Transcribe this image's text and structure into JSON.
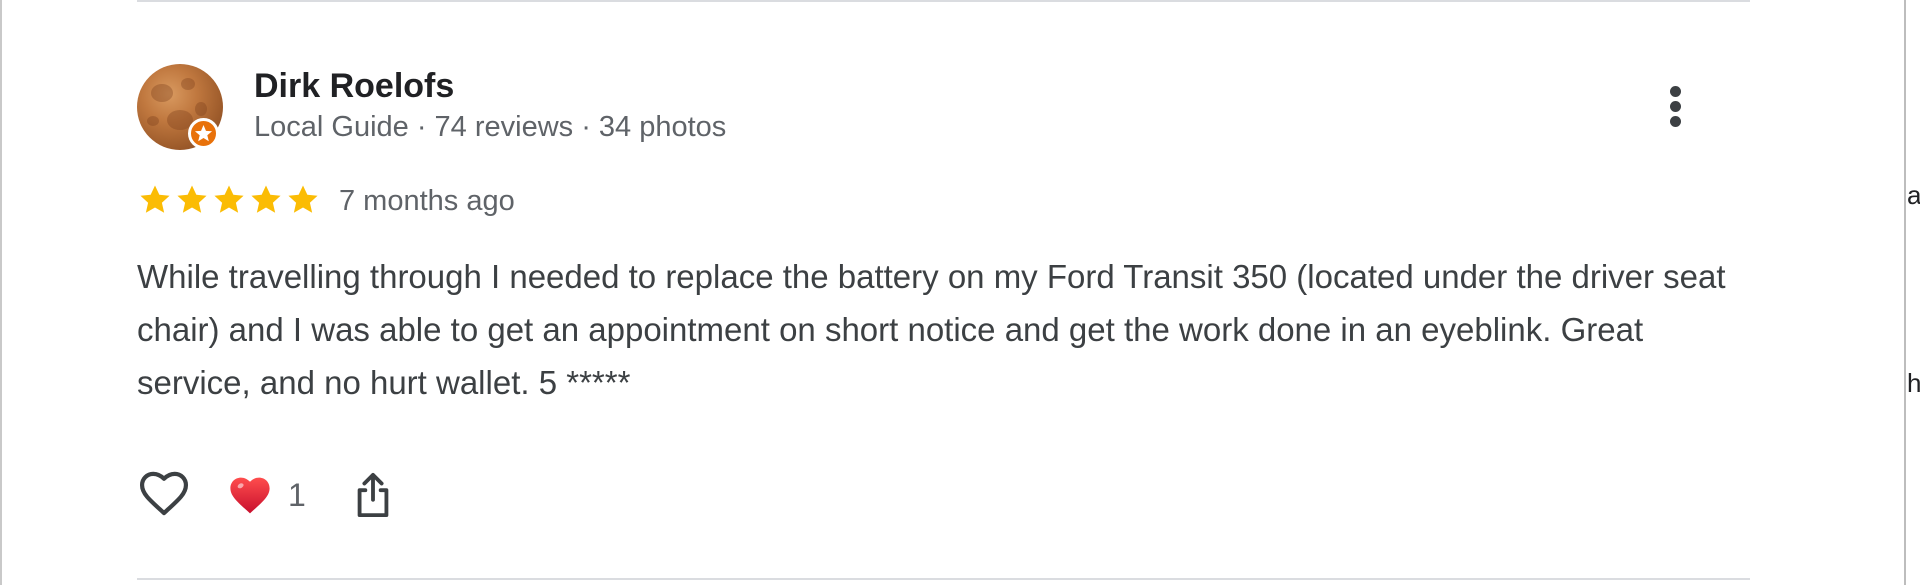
{
  "review": {
    "author": {
      "name": "Dirk Roelofs",
      "meta": "Local Guide · 74 reviews · 34 photos",
      "avatar_icon": "moon-photo-avatar",
      "badge_icon": "local-guide-star-icon"
    },
    "rating": 5,
    "rating_max": 5,
    "date": "7 months ago",
    "text": "While travelling through I needed to replace the battery on my Ford Transit 350 (located under the driver seat chair) and I was able to get an appointment on short notice and get the work done in an eyeblink. Great service, and no hurt wallet. 5 *****",
    "actions": {
      "like_icon": "heart-outline-icon",
      "reaction_icon": "red-heart-emoji",
      "reaction_count": "1",
      "share_icon": "share-icon",
      "more_icon": "more-vertical-icon"
    }
  },
  "background_fragments": [
    "a",
    "h"
  ],
  "colors": {
    "star": "#fbbc04",
    "badge": "#e8710a",
    "heart": "#e02020",
    "text": "#3c4043",
    "muted": "#5f6368"
  }
}
